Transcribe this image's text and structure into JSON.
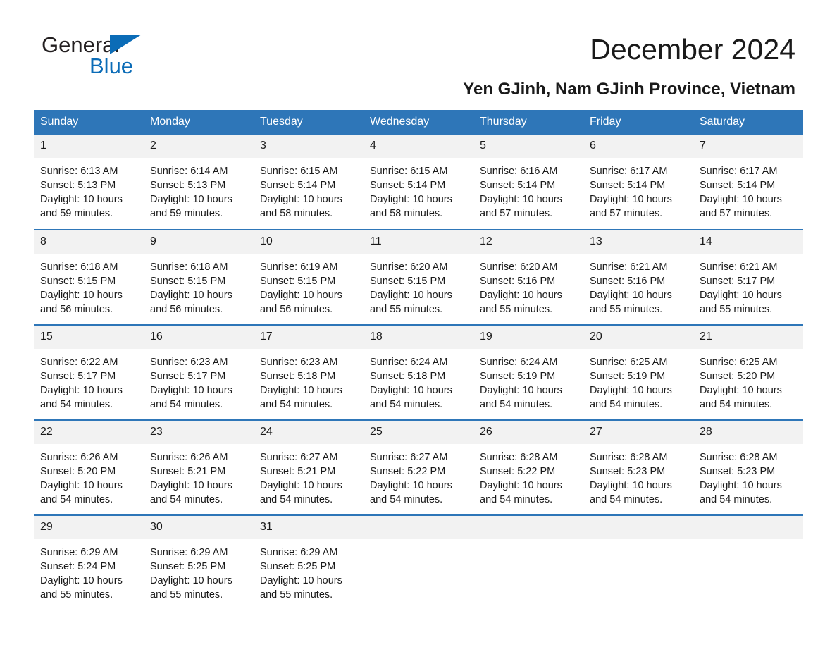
{
  "brand": {
    "name_part1": "General",
    "name_part2": "Blue",
    "triangle_color": "#0b6cb7"
  },
  "header": {
    "title": "December 2024",
    "subtitle": "Yen GJinh, Nam GJinh Province, Vietnam",
    "accent_color": "#2e76b8",
    "daynum_band_color": "#f2f2f2"
  },
  "calendar": {
    "weekday_headers": [
      "Sunday",
      "Monday",
      "Tuesday",
      "Wednesday",
      "Thursday",
      "Friday",
      "Saturday"
    ],
    "labels": {
      "sunrise_prefix": "Sunrise: ",
      "sunset_prefix": "Sunset: ",
      "daylight_prefix": "Daylight: "
    },
    "weeks": [
      [
        {
          "day": "1",
          "sunrise": "Sunrise: 6:13 AM",
          "sunset": "Sunset: 5:13 PM",
          "daylight_line1": "Daylight: 10 hours",
          "daylight_line2": "and 59 minutes."
        },
        {
          "day": "2",
          "sunrise": "Sunrise: 6:14 AM",
          "sunset": "Sunset: 5:13 PM",
          "daylight_line1": "Daylight: 10 hours",
          "daylight_line2": "and 59 minutes."
        },
        {
          "day": "3",
          "sunrise": "Sunrise: 6:15 AM",
          "sunset": "Sunset: 5:14 PM",
          "daylight_line1": "Daylight: 10 hours",
          "daylight_line2": "and 58 minutes."
        },
        {
          "day": "4",
          "sunrise": "Sunrise: 6:15 AM",
          "sunset": "Sunset: 5:14 PM",
          "daylight_line1": "Daylight: 10 hours",
          "daylight_line2": "and 58 minutes."
        },
        {
          "day": "5",
          "sunrise": "Sunrise: 6:16 AM",
          "sunset": "Sunset: 5:14 PM",
          "daylight_line1": "Daylight: 10 hours",
          "daylight_line2": "and 57 minutes."
        },
        {
          "day": "6",
          "sunrise": "Sunrise: 6:17 AM",
          "sunset": "Sunset: 5:14 PM",
          "daylight_line1": "Daylight: 10 hours",
          "daylight_line2": "and 57 minutes."
        },
        {
          "day": "7",
          "sunrise": "Sunrise: 6:17 AM",
          "sunset": "Sunset: 5:14 PM",
          "daylight_line1": "Daylight: 10 hours",
          "daylight_line2": "and 57 minutes."
        }
      ],
      [
        {
          "day": "8",
          "sunrise": "Sunrise: 6:18 AM",
          "sunset": "Sunset: 5:15 PM",
          "daylight_line1": "Daylight: 10 hours",
          "daylight_line2": "and 56 minutes."
        },
        {
          "day": "9",
          "sunrise": "Sunrise: 6:18 AM",
          "sunset": "Sunset: 5:15 PM",
          "daylight_line1": "Daylight: 10 hours",
          "daylight_line2": "and 56 minutes."
        },
        {
          "day": "10",
          "sunrise": "Sunrise: 6:19 AM",
          "sunset": "Sunset: 5:15 PM",
          "daylight_line1": "Daylight: 10 hours",
          "daylight_line2": "and 56 minutes."
        },
        {
          "day": "11",
          "sunrise": "Sunrise: 6:20 AM",
          "sunset": "Sunset: 5:15 PM",
          "daylight_line1": "Daylight: 10 hours",
          "daylight_line2": "and 55 minutes."
        },
        {
          "day": "12",
          "sunrise": "Sunrise: 6:20 AM",
          "sunset": "Sunset: 5:16 PM",
          "daylight_line1": "Daylight: 10 hours",
          "daylight_line2": "and 55 minutes."
        },
        {
          "day": "13",
          "sunrise": "Sunrise: 6:21 AM",
          "sunset": "Sunset: 5:16 PM",
          "daylight_line1": "Daylight: 10 hours",
          "daylight_line2": "and 55 minutes."
        },
        {
          "day": "14",
          "sunrise": "Sunrise: 6:21 AM",
          "sunset": "Sunset: 5:17 PM",
          "daylight_line1": "Daylight: 10 hours",
          "daylight_line2": "and 55 minutes."
        }
      ],
      [
        {
          "day": "15",
          "sunrise": "Sunrise: 6:22 AM",
          "sunset": "Sunset: 5:17 PM",
          "daylight_line1": "Daylight: 10 hours",
          "daylight_line2": "and 54 minutes."
        },
        {
          "day": "16",
          "sunrise": "Sunrise: 6:23 AM",
          "sunset": "Sunset: 5:17 PM",
          "daylight_line1": "Daylight: 10 hours",
          "daylight_line2": "and 54 minutes."
        },
        {
          "day": "17",
          "sunrise": "Sunrise: 6:23 AM",
          "sunset": "Sunset: 5:18 PM",
          "daylight_line1": "Daylight: 10 hours",
          "daylight_line2": "and 54 minutes."
        },
        {
          "day": "18",
          "sunrise": "Sunrise: 6:24 AM",
          "sunset": "Sunset: 5:18 PM",
          "daylight_line1": "Daylight: 10 hours",
          "daylight_line2": "and 54 minutes."
        },
        {
          "day": "19",
          "sunrise": "Sunrise: 6:24 AM",
          "sunset": "Sunset: 5:19 PM",
          "daylight_line1": "Daylight: 10 hours",
          "daylight_line2": "and 54 minutes."
        },
        {
          "day": "20",
          "sunrise": "Sunrise: 6:25 AM",
          "sunset": "Sunset: 5:19 PM",
          "daylight_line1": "Daylight: 10 hours",
          "daylight_line2": "and 54 minutes."
        },
        {
          "day": "21",
          "sunrise": "Sunrise: 6:25 AM",
          "sunset": "Sunset: 5:20 PM",
          "daylight_line1": "Daylight: 10 hours",
          "daylight_line2": "and 54 minutes."
        }
      ],
      [
        {
          "day": "22",
          "sunrise": "Sunrise: 6:26 AM",
          "sunset": "Sunset: 5:20 PM",
          "daylight_line1": "Daylight: 10 hours",
          "daylight_line2": "and 54 minutes."
        },
        {
          "day": "23",
          "sunrise": "Sunrise: 6:26 AM",
          "sunset": "Sunset: 5:21 PM",
          "daylight_line1": "Daylight: 10 hours",
          "daylight_line2": "and 54 minutes."
        },
        {
          "day": "24",
          "sunrise": "Sunrise: 6:27 AM",
          "sunset": "Sunset: 5:21 PM",
          "daylight_line1": "Daylight: 10 hours",
          "daylight_line2": "and 54 minutes."
        },
        {
          "day": "25",
          "sunrise": "Sunrise: 6:27 AM",
          "sunset": "Sunset: 5:22 PM",
          "daylight_line1": "Daylight: 10 hours",
          "daylight_line2": "and 54 minutes."
        },
        {
          "day": "26",
          "sunrise": "Sunrise: 6:28 AM",
          "sunset": "Sunset: 5:22 PM",
          "daylight_line1": "Daylight: 10 hours",
          "daylight_line2": "and 54 minutes."
        },
        {
          "day": "27",
          "sunrise": "Sunrise: 6:28 AM",
          "sunset": "Sunset: 5:23 PM",
          "daylight_line1": "Daylight: 10 hours",
          "daylight_line2": "and 54 minutes."
        },
        {
          "day": "28",
          "sunrise": "Sunrise: 6:28 AM",
          "sunset": "Sunset: 5:23 PM",
          "daylight_line1": "Daylight: 10 hours",
          "daylight_line2": "and 54 minutes."
        }
      ],
      [
        {
          "day": "29",
          "sunrise": "Sunrise: 6:29 AM",
          "sunset": "Sunset: 5:24 PM",
          "daylight_line1": "Daylight: 10 hours",
          "daylight_line2": "and 55 minutes."
        },
        {
          "day": "30",
          "sunrise": "Sunrise: 6:29 AM",
          "sunset": "Sunset: 5:25 PM",
          "daylight_line1": "Daylight: 10 hours",
          "daylight_line2": "and 55 minutes."
        },
        {
          "day": "31",
          "sunrise": "Sunrise: 6:29 AM",
          "sunset": "Sunset: 5:25 PM",
          "daylight_line1": "Daylight: 10 hours",
          "daylight_line2": "and 55 minutes."
        },
        {
          "day": "",
          "sunrise": "",
          "sunset": "",
          "daylight_line1": "",
          "daylight_line2": "",
          "blank": true
        },
        {
          "day": "",
          "sunrise": "",
          "sunset": "",
          "daylight_line1": "",
          "daylight_line2": "",
          "blank": true
        },
        {
          "day": "",
          "sunrise": "",
          "sunset": "",
          "daylight_line1": "",
          "daylight_line2": "",
          "blank": true
        },
        {
          "day": "",
          "sunrise": "",
          "sunset": "",
          "daylight_line1": "",
          "daylight_line2": "",
          "blank": true
        }
      ]
    ]
  }
}
